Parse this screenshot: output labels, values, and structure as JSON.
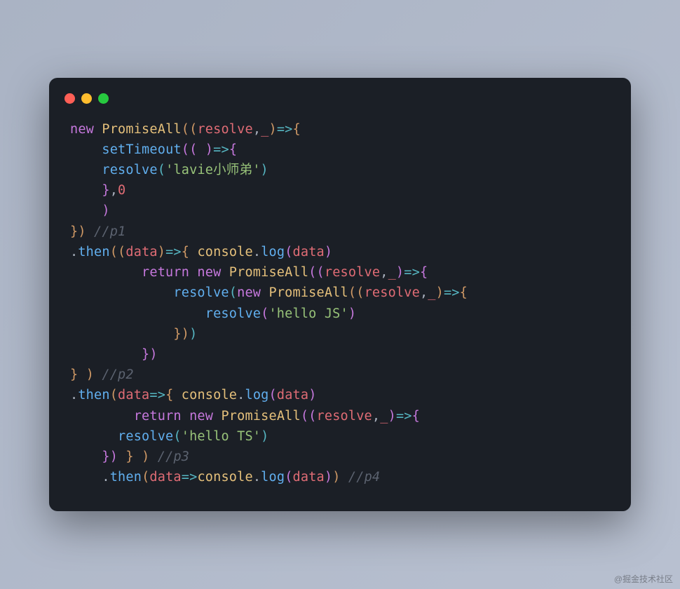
{
  "window": {
    "buttons": [
      "close",
      "minimize",
      "zoom"
    ]
  },
  "code": {
    "l1": {
      "kw_new": "new",
      "cls": "PromiseAll",
      "p1": "resolve",
      "p2": "_"
    },
    "l2": {
      "indent": "    ",
      "fn": "setTimeout"
    },
    "l3": {
      "indent": "    ",
      "fn": "resolve",
      "str": "'lavie小师弟'"
    },
    "l4": {
      "indent": "    ",
      "num": "0"
    },
    "l5": {
      "indent": "    "
    },
    "l6": {
      "cm": "//p1"
    },
    "l7": {
      "fn": "then",
      "p": "data",
      "obj": "console",
      "prop": "log",
      "arg": "data"
    },
    "l8": {
      "indent": "         ",
      "kw": "return",
      "kw_new": "new",
      "cls": "PromiseAll",
      "p1": "resolve",
      "p2": "_"
    },
    "l9": {
      "indent": "             ",
      "fn": "resolve",
      "kw_new": "new",
      "cls": "PromiseAll",
      "p1": "resolve",
      "p2": "_"
    },
    "l10": {
      "indent": "                 ",
      "fn": "resolve",
      "str": "'hello JS'"
    },
    "l11": {
      "indent": "             "
    },
    "l12": {
      "indent": "         "
    },
    "l13": {
      "cm": "//p2"
    },
    "l14": {
      "fn": "then",
      "p": "data",
      "obj": "console",
      "prop": "log",
      "arg": "data"
    },
    "l15": {
      "indent": "        ",
      "kw": "return",
      "kw_new": "new",
      "cls": "PromiseAll",
      "p1": "resolve",
      "p2": "_"
    },
    "l16": {
      "indent": "      ",
      "fn": "resolve",
      "str": "'hello TS'"
    },
    "l17": {
      "indent": "    ",
      "cm": "//p3"
    },
    "l18": {
      "indent": "    ",
      "fn": "then",
      "p": "data",
      "obj": "console",
      "prop": "log",
      "arg": "data",
      "cm": "//p4"
    }
  },
  "watermark": "@掘金技术社区"
}
